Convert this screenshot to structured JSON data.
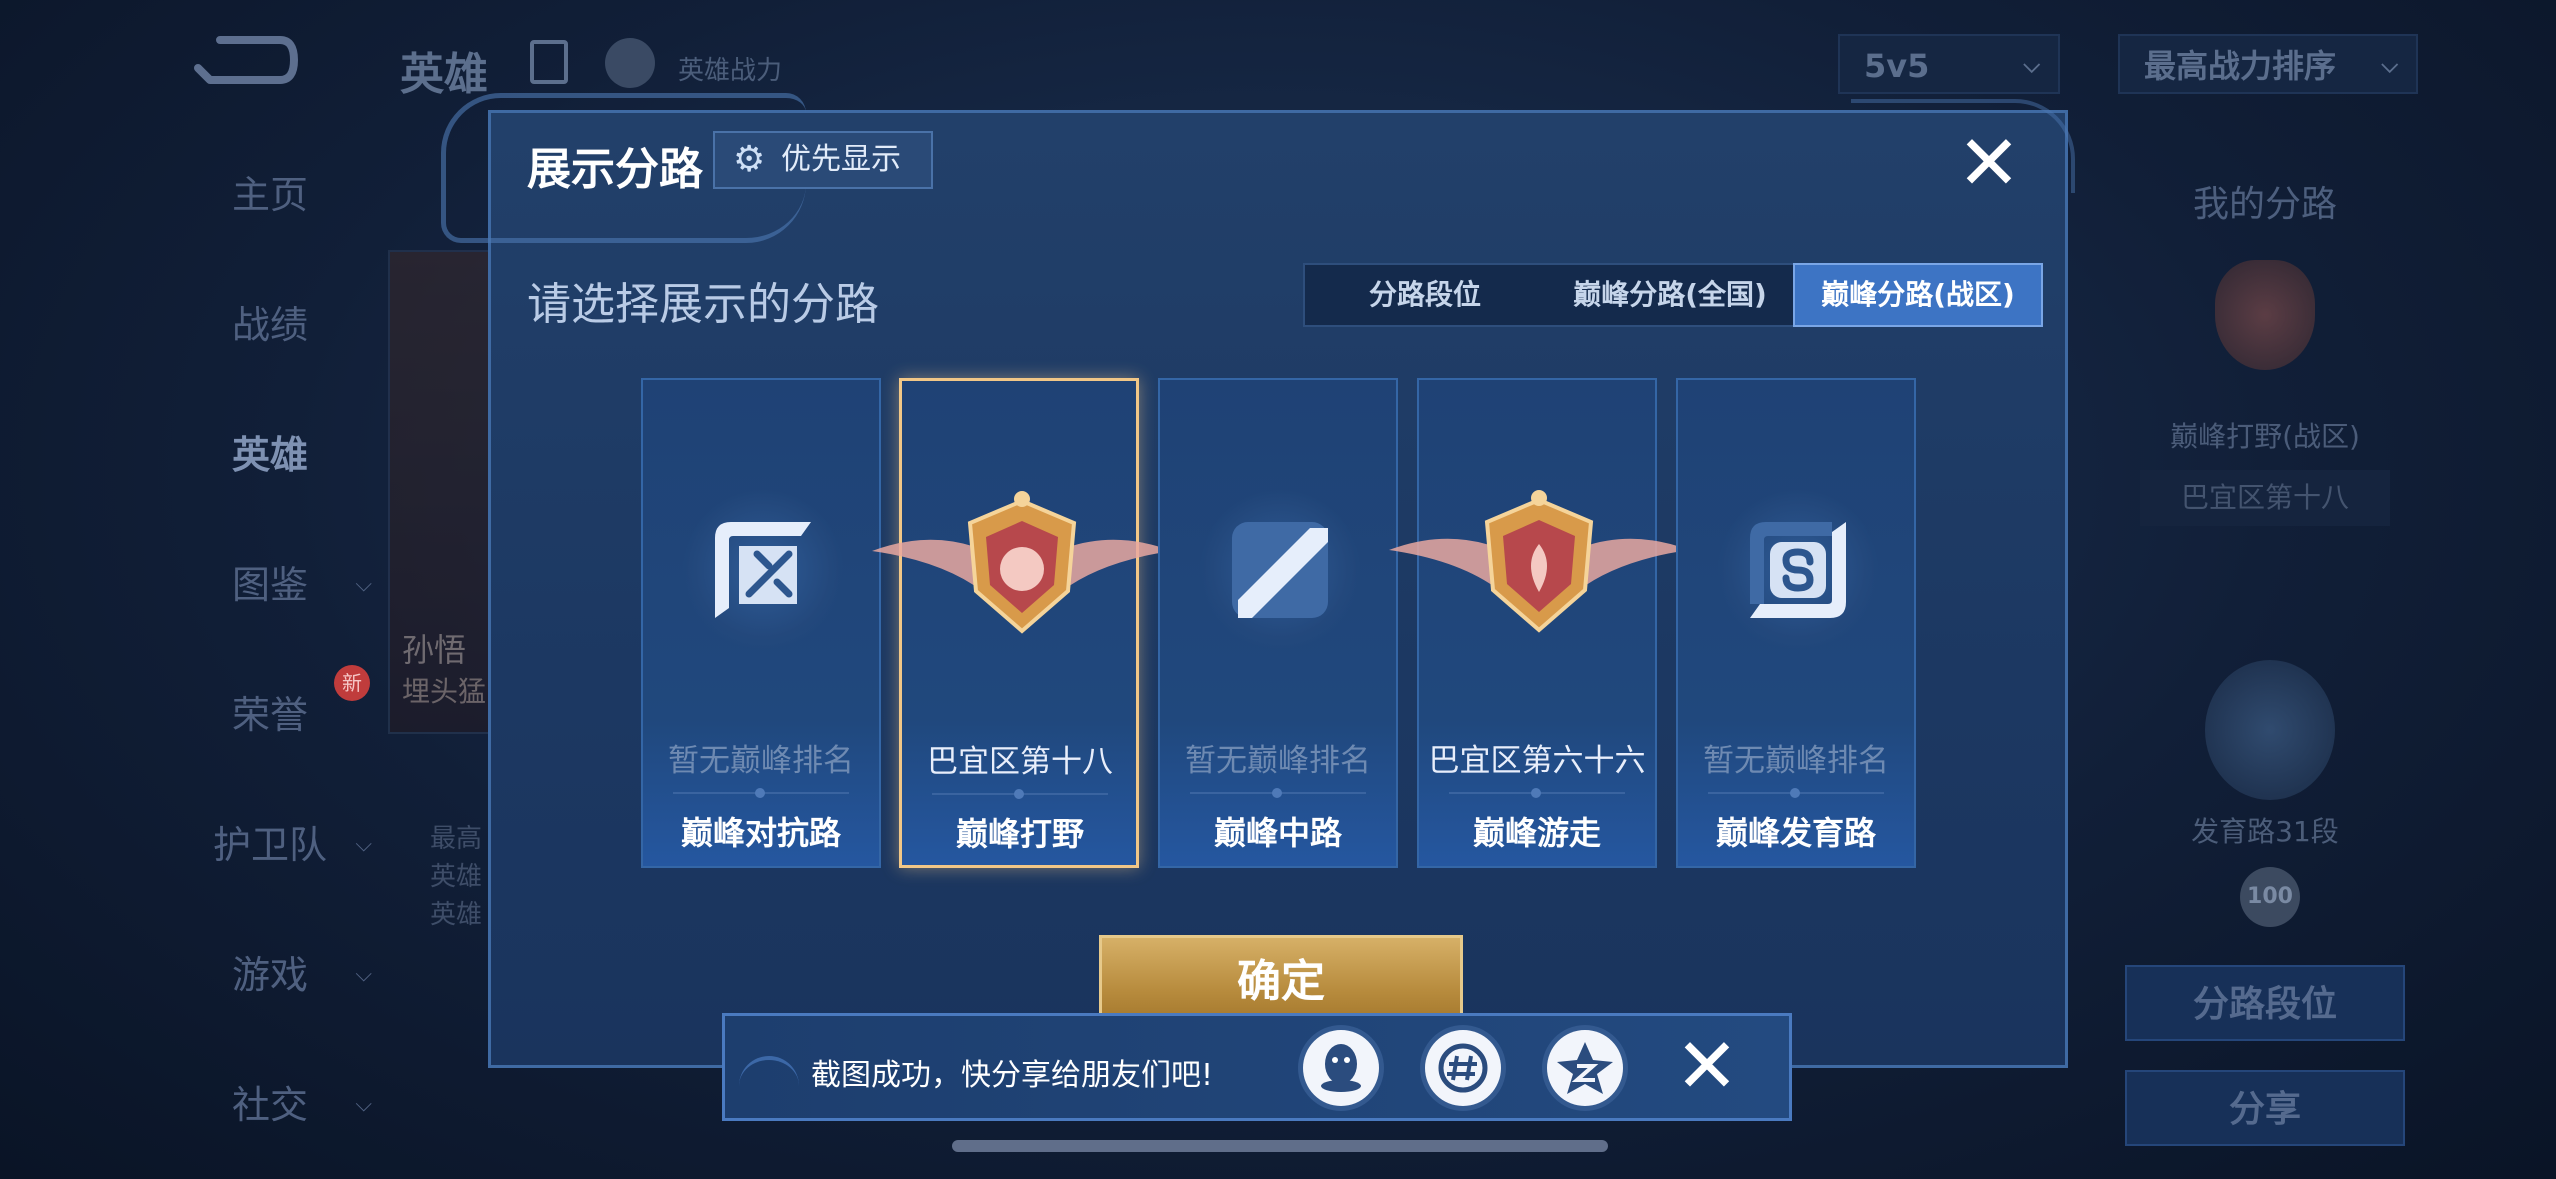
{
  "background": {
    "title": "英雄",
    "subtitle": "英雄战力",
    "mode_select": "5v5",
    "sort_select": "最高战力排序",
    "sidebar": [
      "主页",
      "战绩",
      "英雄",
      "图鉴",
      "荣誉",
      "护卫队",
      "游戏",
      "社交"
    ],
    "new_badge": "新",
    "hero_name": "孙悟",
    "hero_sub": "埋头猛",
    "stats": [
      "最高",
      "英雄",
      "英雄"
    ],
    "right_panel": {
      "title": "我的分路",
      "lane": "巅峰打野(战区)",
      "region": "巴宜区第十八",
      "rank": "发育路31段",
      "level": "100",
      "btn_lane_rank": "分路段位",
      "btn_share": "分享"
    }
  },
  "modal": {
    "title": "展示分路",
    "pref_button": "优先显示",
    "prompt": "请选择展示的分路",
    "tabs": [
      "分路段位",
      "巅峰分路(全国)",
      "巅峰分路(战区)"
    ],
    "active_tab": 2,
    "cards": [
      {
        "status": "暂无巅峰排名",
        "lane": "巅峰对抗路",
        "ranked": false,
        "icon": "clash-lane-icon"
      },
      {
        "status": "巴宜区第十八",
        "lane": "巅峰打野",
        "ranked": true,
        "icon": "jungle-emblem-icon"
      },
      {
        "status": "暂无巅峰排名",
        "lane": "巅峰中路",
        "ranked": false,
        "icon": "mid-lane-icon"
      },
      {
        "status": "巴宜区第六十六",
        "lane": "巅峰游走",
        "ranked": true,
        "icon": "roam-emblem-icon"
      },
      {
        "status": "暂无巅峰排名",
        "lane": "巅峰发育路",
        "ranked": false,
        "icon": "farm-lane-icon"
      }
    ],
    "selected_card": 1,
    "confirm": "确定"
  },
  "toast": {
    "message": "截图成功，快分享给朋友们吧!",
    "share_icons": [
      "qq-icon",
      "wechat-moments-icon",
      "qzone-icon"
    ]
  },
  "colors": {
    "modal_bg": "#1c3862",
    "accent_blue": "#3d74c4",
    "gold": "#d6b067",
    "selected_border": "#f1c787"
  }
}
